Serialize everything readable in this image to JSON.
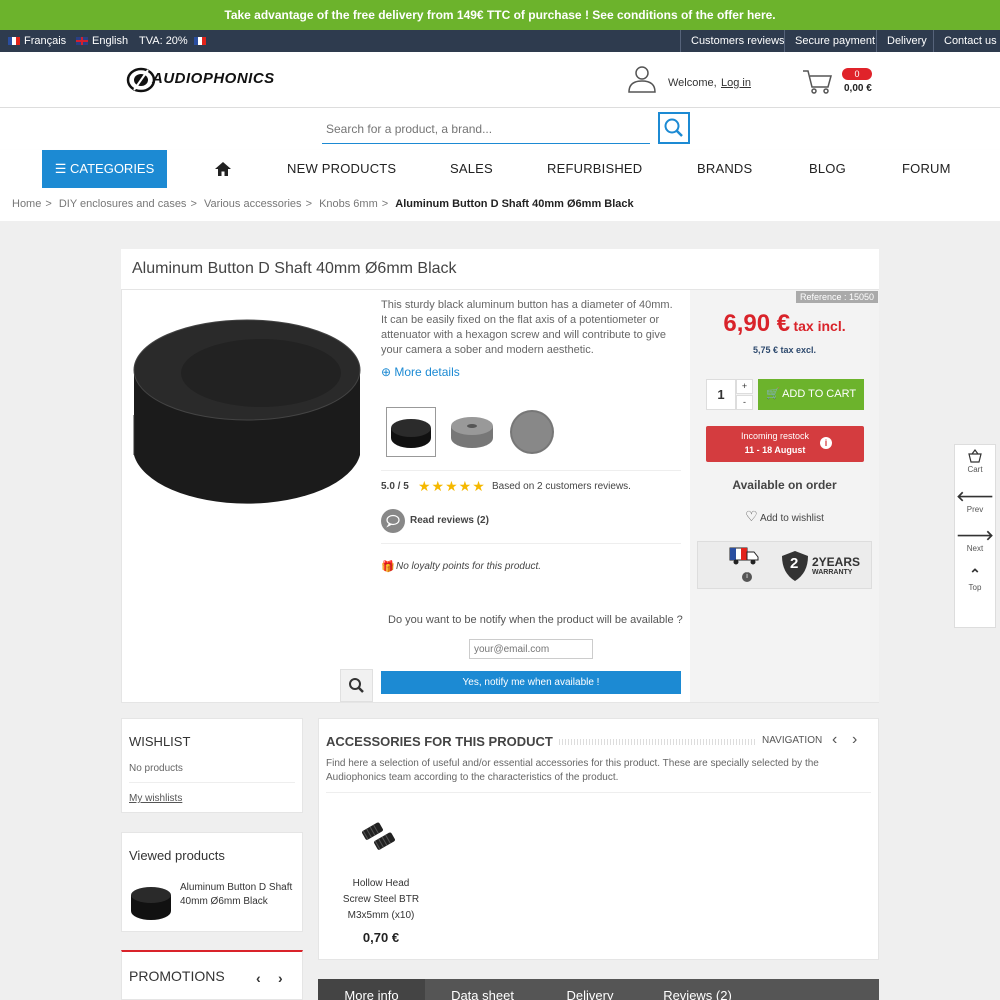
{
  "banner": "Take advantage of the free delivery from 149€ TTC of purchase ! See conditions of the offer here.",
  "langbar": {
    "french": "Français",
    "english": "English",
    "vat": "TVA: 20%",
    "links": [
      "Customers reviews",
      "Secure payment",
      "Delivery",
      "Contact us"
    ]
  },
  "header": {
    "logo": "AUDIOPHONICS",
    "welcome": "Welcome,",
    "login": "Log in",
    "cart_count": "0",
    "cart_total": "0,00 €"
  },
  "search": {
    "placeholder": "Search for a product, a brand..."
  },
  "nav": {
    "categories": "CATEGORIES",
    "items": [
      "NEW PRODUCTS",
      "SALES",
      "REFURBISHED",
      "BRANDS",
      "BLOG",
      "FORUM"
    ]
  },
  "breadcrumb": [
    "Home",
    "DIY enclosures and cases",
    "Various accessories",
    "Knobs 6mm",
    "Aluminum Button D Shaft 40mm Ø6mm Black"
  ],
  "product": {
    "title": "Aluminum Button D Shaft 40mm Ø6mm Black",
    "description": "This sturdy black aluminum button has a diameter of 40mm. It can be easily fixed on the flat axis of a potentiometer or attenuator with a hexagon screw and will contribute to give your camera a sober and modern aesthetic.",
    "more_details": "More details",
    "rating": "5.0 / 5",
    "stars": "★★★★★",
    "reviews_based": "Based on 2 customers reviews.",
    "read_reviews": "Read reviews (2)",
    "loyalty": "No loyalty points for this product.",
    "notify_question": "Do you want to be notify when the product will be available ?",
    "email_placeholder": "your@email.com",
    "notify_button": "Yes, notify me when available !",
    "reference": "Reference : 15050",
    "price": "6,90 €",
    "price_suffix": "tax incl.",
    "price_excl": "5,75 € tax excl.",
    "quantity": "1",
    "plus": "+",
    "minus": "-",
    "add_to_cart": "ADD TO CART",
    "restock_label": "Incoming restock",
    "restock_dates": "11 - 18 August",
    "availability": "Available on order",
    "wishlist": "Add to wishlist",
    "warranty_number": "2",
    "warranty_years": "2YEARS",
    "warranty_word": "WARRANTY"
  },
  "sidetools": [
    "Cart",
    "Prev",
    "Next",
    "Top"
  ],
  "wishlist": {
    "title": "WISHLIST",
    "empty": "No products",
    "link": "My wishlists"
  },
  "viewed": {
    "title": "Viewed products",
    "item": "Aluminum Button D Shaft 40mm Ø6mm Black"
  },
  "promotions": {
    "title": "PROMOTIONS"
  },
  "accessories": {
    "title": "ACCESSORIES FOR THIS PRODUCT",
    "navigation": "NAVIGATION",
    "intro": "Find here a selection of useful and/or essential accessories for this product. These are specially selected by the Audiophonics team according to the characteristics of the product.",
    "item_name": "Hollow Head Screw Steel BTR M3x5mm (x10)",
    "item_price": "0,70 €"
  },
  "tabs": [
    "More info",
    "Data sheet",
    "Delivery",
    "Reviews (2)"
  ],
  "colors": {
    "green": "#6cb32c",
    "blue": "#1c8ad3",
    "red": "#d9232a",
    "navy": "#2e3b4e"
  }
}
